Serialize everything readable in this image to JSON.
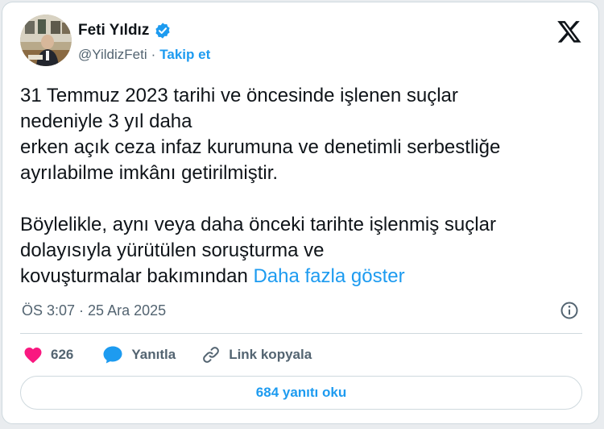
{
  "author": {
    "name": "Feti Yıldız",
    "handle": "@YildizFeti",
    "separator": "·",
    "follow_label": "Takip et",
    "verified_color": "#1d9bf0"
  },
  "icons": {
    "logo": "x-logo-icon",
    "verified": "verified-badge-icon",
    "info": "info-icon",
    "like": "heart-icon",
    "reply": "chat-bubble-icon",
    "copy_link": "link-icon"
  },
  "tweet": {
    "lines_p1": [
      "31 Temmuz 2023 tarihi ve öncesinde işlenen suçlar",
      "nedeniyle 3 yıl daha",
      "erken açık ceza infaz kurumuna ve denetimli serbestliğe",
      "ayrılabilme imkânı getirilmiştir."
    ],
    "lines_p2": [
      "Böylelikle, aynı veya daha önceki tarihte işlenmiş suçlar",
      "dolayısıyla yürütülen soruşturma ve",
      "kovuşturmalar bakımından "
    ],
    "show_more": "Daha fazla göster",
    "timestamp": "ÖS 3:07 · 25 Ara 2025"
  },
  "actions": {
    "likes": "626",
    "reply_label": "Yanıtla",
    "copy_link_label": "Link kopyala"
  },
  "read_replies_label": "684 yanıtı oku",
  "colors": {
    "accent": "#1d9bf0",
    "like": "#f91880",
    "text": "#0f1419",
    "muted": "#536471",
    "border": "#cfd9de"
  }
}
